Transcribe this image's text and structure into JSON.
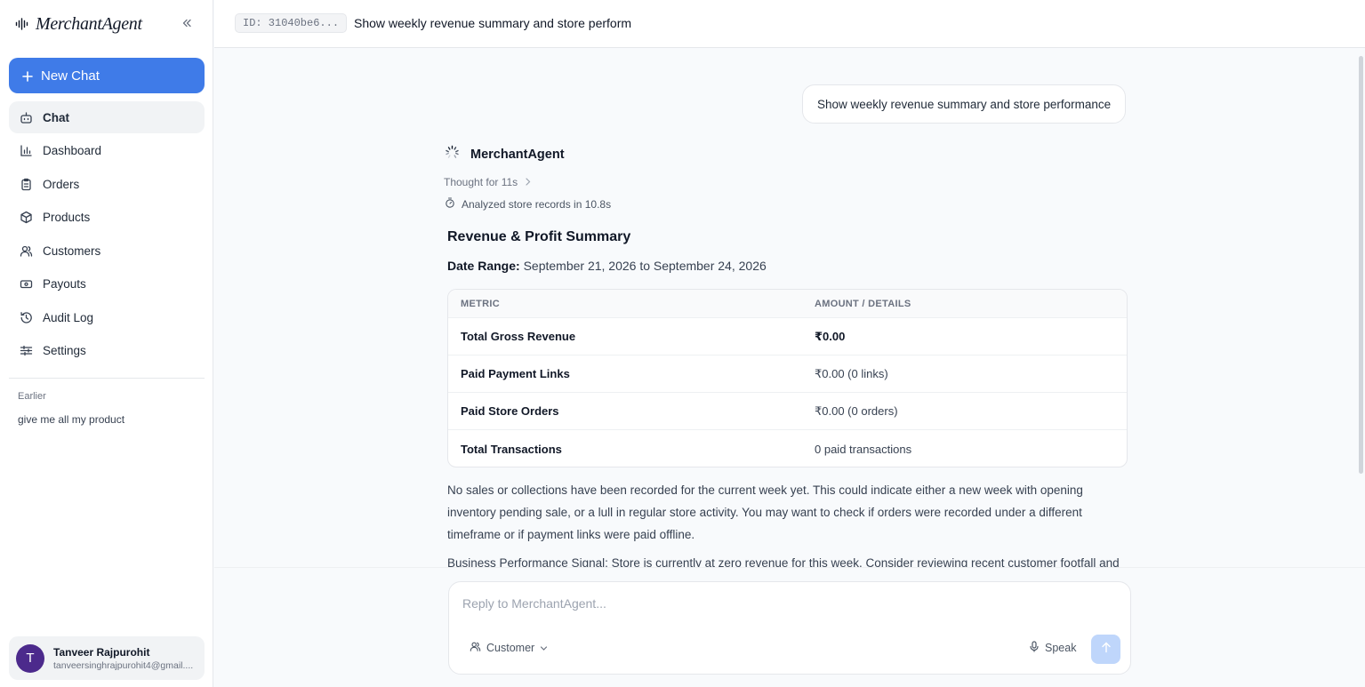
{
  "sidebar": {
    "brand": "MerchantAgent",
    "new_chat_label": "New Chat",
    "nav": [
      {
        "label": "Chat",
        "icon": "bot-icon",
        "active": true
      },
      {
        "label": "Dashboard",
        "icon": "bar-chart-icon"
      },
      {
        "label": "Orders",
        "icon": "clipboard-icon"
      },
      {
        "label": "Products",
        "icon": "package-icon"
      },
      {
        "label": "Customers",
        "icon": "users-icon"
      },
      {
        "label": "Payouts",
        "icon": "banknote-icon"
      },
      {
        "label": "Audit Log",
        "icon": "history-icon"
      },
      {
        "label": "Settings",
        "icon": "sliders-icon"
      }
    ],
    "earlier_label": "Earlier",
    "history": [
      "give me all my product"
    ],
    "user": {
      "initial": "T",
      "name": "Tanveer Rajpurohit",
      "email": "tanveersinghrajpurohit4@gmail...."
    }
  },
  "header": {
    "chat_id": "ID: 31040be6...",
    "title": "Show weekly revenue summary and store perform"
  },
  "conversation": {
    "user_message": "Show weekly revenue summary and store performance",
    "agent_name": "MerchantAgent",
    "thought": "Thought for 11s",
    "analyzed": "Analyzed store records in 10.8s",
    "summary_title": "Revenue & Profit Summary",
    "date_range_label": "Date Range:",
    "date_range_value": "September 21, 2026 to September 24, 2026",
    "table": {
      "headers": [
        "METRIC",
        "AMOUNT / DETAILS"
      ],
      "rows": [
        {
          "metric": "Total Gross Revenue",
          "value": "₹0.00"
        },
        {
          "metric": "Paid Payment Links",
          "value": "₹0.00 (0 links)"
        },
        {
          "metric": "Paid Store Orders",
          "value": "₹0.00 (0 orders)"
        },
        {
          "metric": "Total Transactions",
          "value": "0 paid transactions"
        }
      ]
    },
    "paragraph_1": "No sales or collections have been recorded for the current week yet. This could indicate either a new week with opening inventory pending sale, or a lull in regular store activity. You may want to check if orders were recorded under a different timeframe or if payment links were paid offline.",
    "paragraph_2": "Business Performance Signal: Store is currently at zero revenue for this week. Consider reviewing recent customer footfall and"
  },
  "composer": {
    "placeholder": "Reply to MerchantAgent...",
    "mode_label": "Customer",
    "speak_label": "Speak"
  },
  "colors": {
    "accent": "#3f7be8",
    "avatar": "#4c2a8c",
    "send_disabled": "#bfd6fb"
  }
}
